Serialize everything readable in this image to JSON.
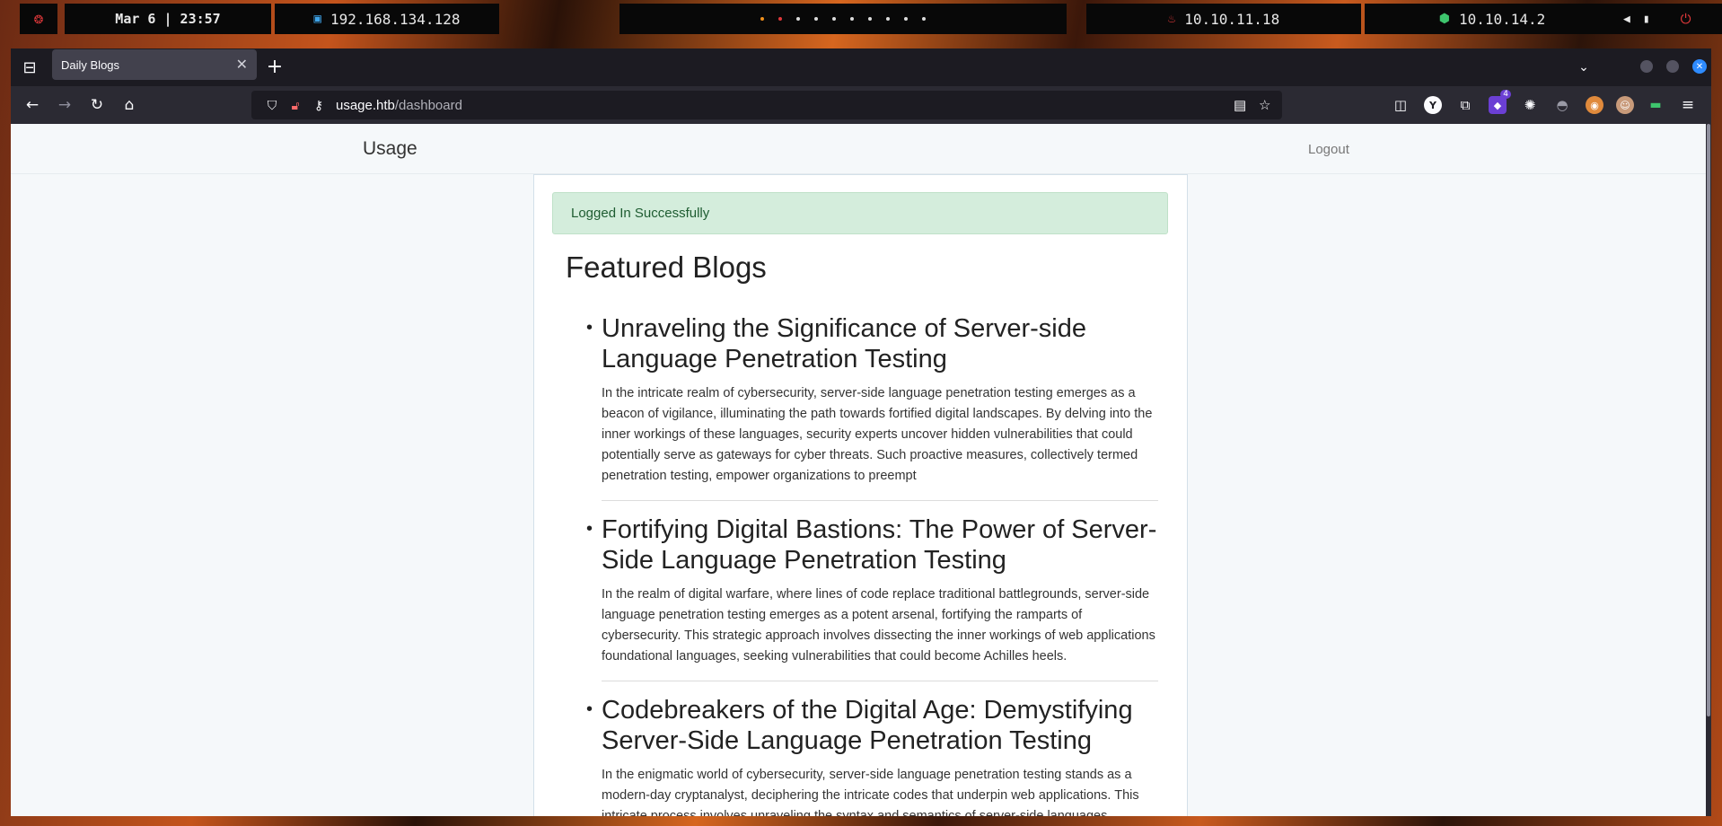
{
  "system_panel": {
    "datetime": "Mar 6 | 23:57",
    "vm_ip": "192.168.134.128",
    "target_ip": "10.10.11.18",
    "vpn_ip": "10.10.14.2"
  },
  "browser": {
    "tab_title": "Daily Blogs",
    "url_host": "usage.htb",
    "url_path": "/dashboard",
    "extension_badge": "4"
  },
  "site": {
    "brand": "Usage",
    "logout_label": "Logout",
    "alert": "Logged In Successfully",
    "heading": "Featured Blogs",
    "posts": [
      {
        "title": "Unraveling the Significance of Server-side Language Penetration Testing",
        "body": "In the intricate realm of cybersecurity, server-side language penetration testing emerges as a beacon of vigilance, illuminating the path towards fortified digital landscapes. By delving into the inner workings of these languages, security experts uncover hidden vulnerabilities that could potentially serve as gateways for cyber threats. Such proactive measures, collectively termed penetration testing, empower organizations to preempt"
      },
      {
        "title": "Fortifying Digital Bastions: The Power of Server-Side Language Penetration Testing",
        "body": "In the realm of digital warfare, where lines of code replace traditional battlegrounds, server-side language penetration testing emerges as a potent arsenal, fortifying the ramparts of cybersecurity. This strategic approach involves dissecting the inner workings of web applications foundational languages, seeking vulnerabilities that could become Achilles heels."
      },
      {
        "title": "Codebreakers of the Digital Age: Demystifying Server-Side Language Penetration Testing",
        "body": "In the enigmatic world of cybersecurity, server-side language penetration testing stands as a modern-day cryptanalyst, deciphering the intricate codes that underpin web applications. This intricate process involves unraveling the syntax and semantics of server-side languages"
      }
    ]
  },
  "colors": {
    "alert_bg": "#d4eddc",
    "browser_chrome": "#1c1b22",
    "page_bg": "#f5f8fa"
  }
}
